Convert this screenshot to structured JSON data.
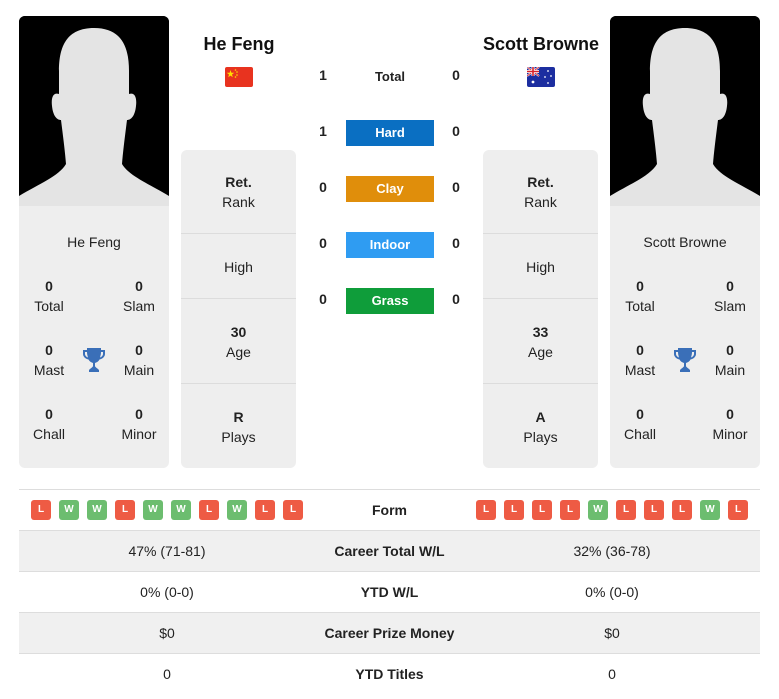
{
  "players": [
    {
      "name": "He Feng",
      "country": "China",
      "flag_icon": "china-flag-icon",
      "rank_value": "Ret.",
      "rank_label": "Rank",
      "high_label": "High",
      "age": "30",
      "age_label": "Age",
      "plays": "R",
      "plays_label": "Plays",
      "titles": {
        "total": "0",
        "total_label": "Total",
        "slam": "0",
        "slam_label": "Slam",
        "mast": "0",
        "mast_label": "Mast",
        "main": "0",
        "main_label": "Main",
        "chall": "0",
        "chall_label": "Chall",
        "minor": "0",
        "minor_label": "Minor"
      },
      "form": [
        "L",
        "W",
        "W",
        "L",
        "W",
        "W",
        "L",
        "W",
        "L",
        "L"
      ]
    },
    {
      "name": "Scott Browne",
      "country": "Australia",
      "flag_icon": "australia-flag-icon",
      "rank_value": "Ret.",
      "rank_label": "Rank",
      "high_label": "High",
      "age": "33",
      "age_label": "Age",
      "plays": "A",
      "plays_label": "Plays",
      "titles": {
        "total": "0",
        "total_label": "Total",
        "slam": "0",
        "slam_label": "Slam",
        "mast": "0",
        "mast_label": "Mast",
        "main": "0",
        "main_label": "Main",
        "chall": "0",
        "chall_label": "Chall",
        "minor": "0",
        "minor_label": "Minor"
      },
      "form": [
        "L",
        "L",
        "L",
        "L",
        "W",
        "L",
        "L",
        "L",
        "W",
        "L"
      ]
    }
  ],
  "h2h": [
    {
      "label": "Total",
      "left": "1",
      "right": "0",
      "color": null
    },
    {
      "label": "Hard",
      "left": "1",
      "right": "0",
      "color": "#0a6fc2"
    },
    {
      "label": "Clay",
      "left": "0",
      "right": "0",
      "color": "#e08e0b"
    },
    {
      "label": "Indoor",
      "left": "0",
      "right": "0",
      "color": "#2f9cf2"
    },
    {
      "label": "Grass",
      "left": "0",
      "right": "0",
      "color": "#0f9d3a"
    }
  ],
  "table": {
    "form_label": "Form",
    "rows": [
      {
        "label": "Career Total W/L",
        "left": "47% (71-81)",
        "right": "32% (36-78)"
      },
      {
        "label": "YTD W/L",
        "left": "0% (0-0)",
        "right": "0% (0-0)"
      },
      {
        "label": "Career Prize Money",
        "left": "$0",
        "right": "$0"
      },
      {
        "label": "YTD Titles",
        "left": "0",
        "right": "0"
      }
    ]
  },
  "colors": {
    "loss": "#ee5b44",
    "win": "#6cbd6f",
    "trophy": "#3a6fb8"
  }
}
